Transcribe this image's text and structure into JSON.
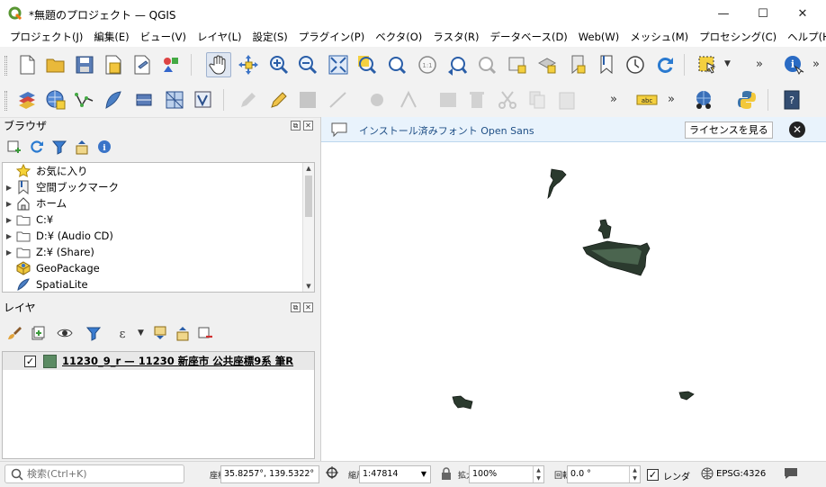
{
  "window": {
    "title": "*無題のプロジェクト — QGIS",
    "minimize": "—",
    "maximize": "☐",
    "close": "✕"
  },
  "menu": [
    "プロジェクト(J)",
    "編集(E)",
    "ビュー(V)",
    "レイヤ(L)",
    "設定(S)",
    "プラグイン(P)",
    "ベクタ(O)",
    "ラスタ(R)",
    "データベース(D)",
    "Web(W)",
    "メッシュ(M)",
    "プロセシング(C)",
    "ヘルプ(H)"
  ],
  "toolbar": {
    "more": "»"
  },
  "browser_panel": {
    "title": "ブラウザ",
    "items": [
      {
        "label": "お気に入り",
        "icon": "star-icon",
        "expandable": false
      },
      {
        "label": "空間ブックマーク",
        "icon": "bookmark-icon",
        "expandable": true
      },
      {
        "label": "ホーム",
        "icon": "home-icon",
        "expandable": true
      },
      {
        "label": "C:¥",
        "icon": "folder-icon",
        "expandable": true
      },
      {
        "label": "D:¥ (Audio CD)",
        "icon": "folder-icon",
        "expandable": true
      },
      {
        "label": "Z:¥ (Share)",
        "icon": "folder-icon",
        "expandable": true
      },
      {
        "label": "GeoPackage",
        "icon": "geopackage-icon",
        "expandable": false
      },
      {
        "label": "SpatiaLite",
        "icon": "spatialite-icon",
        "expandable": false
      }
    ]
  },
  "layers_panel": {
    "title": "レイヤ",
    "layers": [
      {
        "name": "11230_9_r — 11230 新座市 公共座標9系 筆R",
        "checked": true,
        "color": "#5b8b63"
      }
    ]
  },
  "message_bar": {
    "text": "インストール済みフォント Open Sans",
    "button": "ライセンスを見る",
    "close": "✕"
  },
  "status": {
    "search_placeholder": "検索(Ctrl+K)",
    "coordinate_label": "座標",
    "coordinate": "35.8257°, 139.5322°",
    "scale_label": "縮尺",
    "scale": "1:47814",
    "magnifier_label": "拡大",
    "magnifier": "100%",
    "rotation_label": "回転",
    "rotation": "0.0 °",
    "render_label": "レンダ",
    "render_checked": true,
    "crs": "EPSG:4326"
  }
}
